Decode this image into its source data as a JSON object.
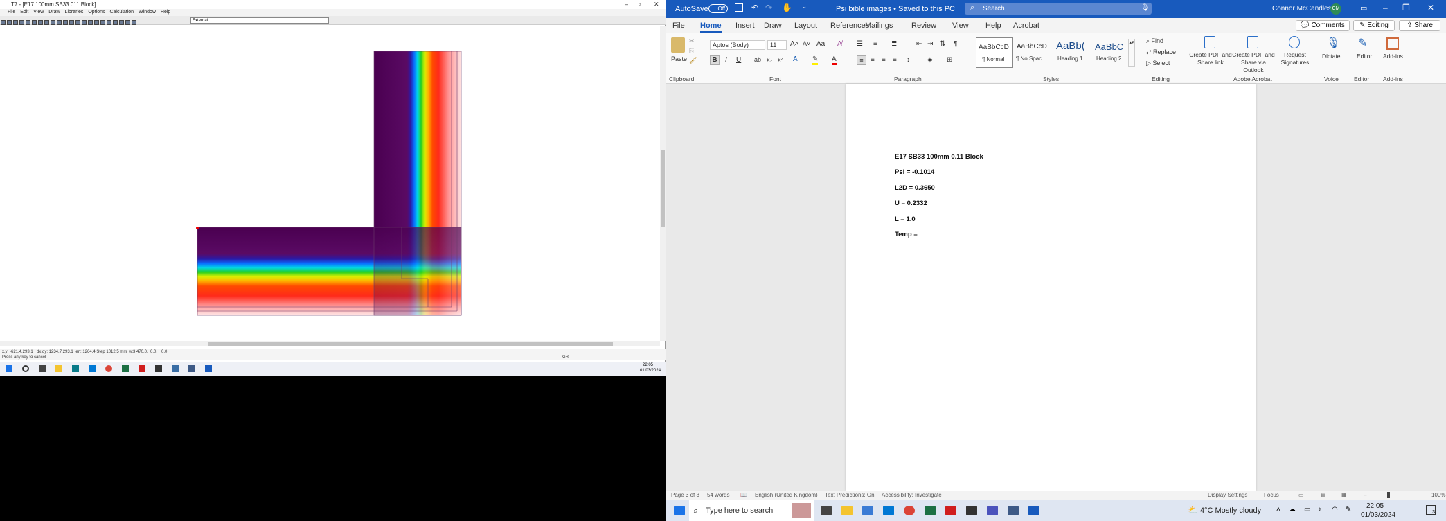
{
  "therm": {
    "title": "T7 - [E17 100mm SB33 011 Block]",
    "menu": [
      "File",
      "Edit",
      "View",
      "Draw",
      "Libraries",
      "Options",
      "Calculation",
      "Window",
      "Help"
    ],
    "combo": "External",
    "status1": [
      "x,y: -621.4,293.1",
      "dx,dy: 1234.7,293.1",
      "len: 1264.4 Step 1012.5 mm",
      "w:3 470.0,",
      "0.0,",
      "0.0"
    ],
    "status2": "Press any key to cancel",
    "status_r": "GR",
    "clock_time": "22:05",
    "clock_date": "01/03/2024"
  },
  "word": {
    "autosave": "AutoSave",
    "autosave_state": "Off",
    "doc_title": "Psi bible images • Saved to this PC",
    "search": "Search",
    "user": "Connor McCandless",
    "initials": "CM",
    "tabs": [
      "File",
      "Home",
      "Insert",
      "Draw",
      "Layout",
      "References",
      "Mailings",
      "Review",
      "View",
      "Help",
      "Acrobat"
    ],
    "comments": "Comments",
    "editing": "Editing",
    "share": "Share",
    "ribbon": {
      "paste": "Paste",
      "font": "Aptos (Body)",
      "size": "11",
      "styles": [
        {
          "preview": "AaBbCcD",
          "name": "¶ Normal"
        },
        {
          "preview": "AaBbCcD",
          "name": "¶ No Spac..."
        },
        {
          "preview": "AaBb(",
          "name": "Heading 1"
        },
        {
          "preview": "AaBbC",
          "name": "Heading 2"
        }
      ],
      "find": "Find",
      "replace": "Replace",
      "select": "Select",
      "acro1": "Create PDF and Share link",
      "acro2": "Create PDF and Share via Outlook",
      "acro3": "Request Signatures",
      "dictate": "Dictate",
      "editor": "Editor",
      "addins": "Add-ins",
      "groups": [
        "Clipboard",
        "Font",
        "Paragraph",
        "Styles",
        "Editing",
        "Adobe Acrobat",
        "Voice",
        "Editor",
        "Add-ins"
      ]
    },
    "doc_lines": [
      "E17 SB33 100mm 0.11 Block",
      "Psi = -0.1014",
      "L2D = 0.3650",
      "U = 0.2332",
      "L = 1.0",
      "Temp ="
    ],
    "status": {
      "page": "Page 3 of 3",
      "words": "54 words",
      "lang": "English (United Kingdom)",
      "pred": "Text Predictions: On",
      "acc": "Accessibility: Investigate",
      "display": "Display Settings",
      "focus": "Focus",
      "zoom": "100%"
    }
  },
  "taskbar": {
    "search": "Type here to search",
    "weather": "4°C  Mostly cloudy",
    "time": "22:05",
    "date": "01/03/2024",
    "notif": "3"
  }
}
